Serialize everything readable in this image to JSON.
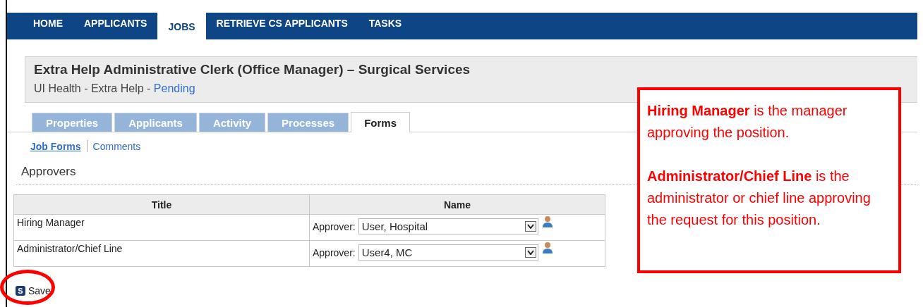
{
  "nav": [
    {
      "label": "HOME",
      "selected": false
    },
    {
      "label": "APPLICANTS",
      "selected": false
    },
    {
      "label": "JOBS",
      "selected": true
    },
    {
      "label": "RETRIEVE CS APPLICANTS",
      "selected": false
    },
    {
      "label": "TASKS",
      "selected": false
    }
  ],
  "job": {
    "title": "Extra Help Administrative Clerk (Office Manager) – Surgical Services",
    "subtitle": "UI Health - Extra Help - ",
    "status": "Pending"
  },
  "tabs": [
    {
      "label": "Properties",
      "selected": false
    },
    {
      "label": "Applicants",
      "selected": false
    },
    {
      "label": "Activity",
      "selected": false
    },
    {
      "label": "Processes",
      "selected": false
    },
    {
      "label": "Forms",
      "selected": true
    }
  ],
  "sublinks": [
    {
      "label": "Job Forms",
      "selected": true
    },
    {
      "label": "Comments",
      "selected": false
    }
  ],
  "section_title": "Approvers",
  "table": {
    "columns": [
      "Title",
      "Name"
    ],
    "rows": [
      {
        "title": "Hiring Manager",
        "prefix": "Approver:",
        "value": "User, Hospital"
      },
      {
        "title": "Administrator/Chief Line",
        "prefix": "Approver:",
        "value": "User4, MC"
      }
    ]
  },
  "save": {
    "key": "S",
    "label": "Save"
  },
  "callout": [
    "**Hiring Manager** is the manager approving the position.",
    "**Administrator/Chief Line** is the administrator or chief line approving the request for this position."
  ]
}
